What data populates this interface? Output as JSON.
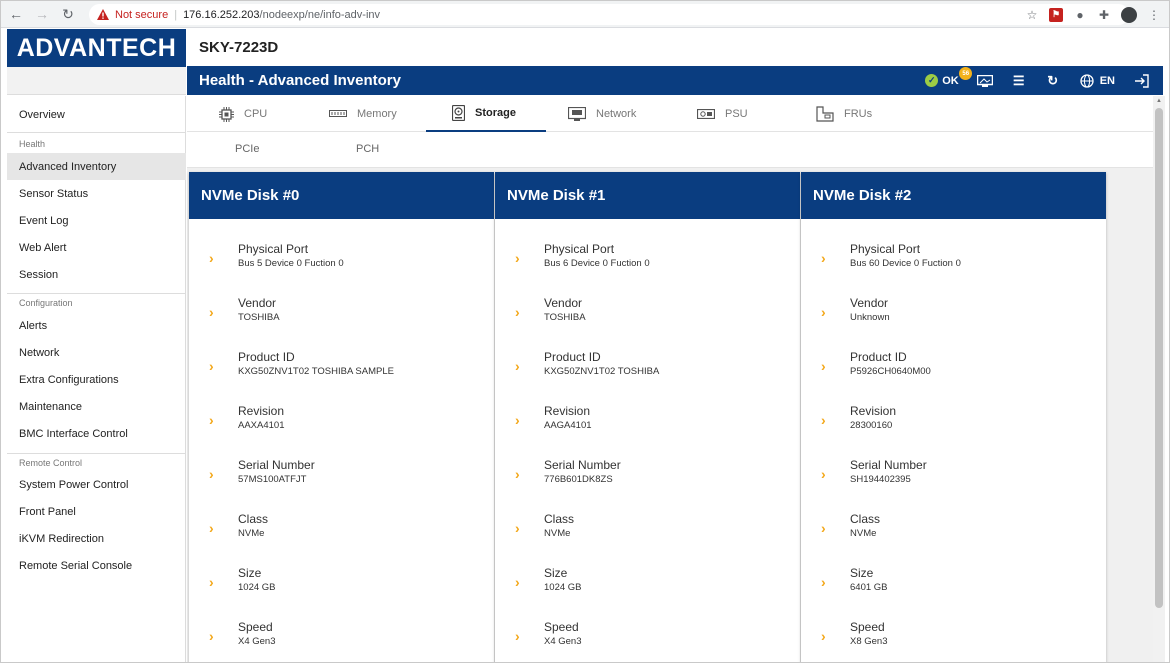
{
  "browser": {
    "security_label": "Not secure",
    "url_host": "176.16.252.203",
    "url_path": "/nodeexp/ne/info-adv-inv"
  },
  "brand": {
    "logo_text": "ADVANTECH"
  },
  "device": {
    "name": "SKY-7223D"
  },
  "header": {
    "title": "Health - Advanced Inventory",
    "status_text": "OK",
    "status_badge": "56",
    "lang_label": "EN"
  },
  "sidebar": {
    "overview": "Overview",
    "health_group": "Health",
    "health_items": [
      "Advanced Inventory",
      "Sensor Status",
      "Event Log",
      "Web Alert",
      "Session"
    ],
    "config_group": "Configuration",
    "config_items": [
      "Alerts",
      "Network",
      "Extra Configurations",
      "Maintenance",
      "BMC Interface Control"
    ],
    "remote_group": "Remote Control",
    "remote_items": [
      "System Power Control",
      "Front Panel",
      "iKVM Redirection",
      "Remote Serial Console"
    ]
  },
  "tabs": [
    "CPU",
    "Memory",
    "Storage",
    "Network",
    "PSU",
    "FRUs"
  ],
  "active_tab": "Storage",
  "subtabs": [
    "PCIe",
    "PCH"
  ],
  "disks": [
    {
      "title": "NVMe Disk #0",
      "fields": [
        {
          "label": "Physical Port",
          "value": "Bus 5 Device 0 Fuction 0"
        },
        {
          "label": "Vendor",
          "value": "TOSHIBA"
        },
        {
          "label": "Product ID",
          "value": "KXG50ZNV1T02 TOSHIBA SAMPLE"
        },
        {
          "label": "Revision",
          "value": "AAXA4101"
        },
        {
          "label": "Serial Number",
          "value": "57MS100ATFJT"
        },
        {
          "label": "Class",
          "value": "NVMe"
        },
        {
          "label": "Size",
          "value": "1024 GB"
        },
        {
          "label": "Speed",
          "value": "X4 Gen3"
        }
      ]
    },
    {
      "title": "NVMe Disk #1",
      "fields": [
        {
          "label": "Physical Port",
          "value": "Bus 6 Device 0 Fuction 0"
        },
        {
          "label": "Vendor",
          "value": "TOSHIBA"
        },
        {
          "label": "Product ID",
          "value": "KXG50ZNV1T02 TOSHIBA"
        },
        {
          "label": "Revision",
          "value": "AAGA4101"
        },
        {
          "label": "Serial Number",
          "value": "776B601DK8ZS"
        },
        {
          "label": "Class",
          "value": "NVMe"
        },
        {
          "label": "Size",
          "value": "1024 GB"
        },
        {
          "label": "Speed",
          "value": "X4 Gen3"
        }
      ]
    },
    {
      "title": "NVMe Disk #2",
      "fields": [
        {
          "label": "Physical Port",
          "value": "Bus 60 Device 0 Fuction 0"
        },
        {
          "label": "Vendor",
          "value": "Unknown"
        },
        {
          "label": "Product ID",
          "value": "P5926CH0640M00"
        },
        {
          "label": "Revision",
          "value": "28300160"
        },
        {
          "label": "Serial Number",
          "value": "SH194402395"
        },
        {
          "label": "Class",
          "value": "NVMe"
        },
        {
          "label": "Size",
          "value": "6401 GB"
        },
        {
          "label": "Speed",
          "value": "X8 Gen3"
        }
      ]
    }
  ],
  "colors": {
    "brand_blue": "#0a3d80",
    "accent_orange": "#f3a81b",
    "status_green": "#9ccc45"
  }
}
